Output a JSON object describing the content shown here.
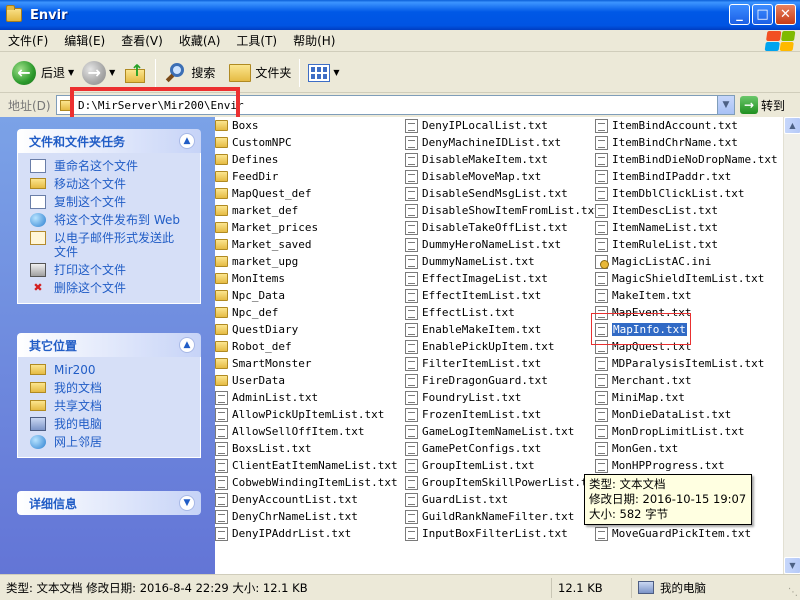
{
  "window": {
    "title": "Envir",
    "btn_minimize": "_",
    "btn_maximize": "□",
    "btn_close": "✕"
  },
  "menu": [
    "文件(F)",
    "编辑(E)",
    "查看(V)",
    "收藏(A)",
    "工具(T)",
    "帮助(H)"
  ],
  "toolbar": {
    "back": "后退",
    "search": "搜索",
    "folders": "文件夹"
  },
  "address": {
    "label": "地址(D)",
    "value": "D:\\MirServer\\Mir200\\Envir",
    "go": "转到"
  },
  "taskpane": {
    "file_tasks": {
      "title": "文件和文件夹任务",
      "items": [
        {
          "label": "重命名这个文件",
          "icon": "rename-icon"
        },
        {
          "label": "移动这个文件",
          "icon": "move-icon"
        },
        {
          "label": "复制这个文件",
          "icon": "copy-icon"
        },
        {
          "label": "将这个文件发布到 Web",
          "icon": "web-publish-icon"
        },
        {
          "label": "以电子邮件形式发送此文件",
          "icon": "email-icon"
        },
        {
          "label": "打印这个文件",
          "icon": "printer-icon"
        },
        {
          "label": "删除这个文件",
          "icon": "delete-icon"
        }
      ]
    },
    "other_places": {
      "title": "其它位置",
      "items": [
        {
          "label": "Mir200",
          "icon": "folder-icon"
        },
        {
          "label": "我的文档",
          "icon": "folder-icon"
        },
        {
          "label": "共享文档",
          "icon": "folder-icon"
        },
        {
          "label": "我的电脑",
          "icon": "computer-icon"
        },
        {
          "label": "网上邻居",
          "icon": "network-icon"
        }
      ]
    },
    "details": {
      "title": "详细信息"
    }
  },
  "files": {
    "col1": [
      {
        "name": "Boxs",
        "type": "folder"
      },
      {
        "name": "CustomNPC",
        "type": "folder"
      },
      {
        "name": "Defines",
        "type": "folder"
      },
      {
        "name": "FeedDir",
        "type": "folder"
      },
      {
        "name": "MapQuest_def",
        "type": "folder"
      },
      {
        "name": "market_def",
        "type": "folder"
      },
      {
        "name": "Market_prices",
        "type": "folder"
      },
      {
        "name": "Market_saved",
        "type": "folder"
      },
      {
        "name": "market_upg",
        "type": "folder"
      },
      {
        "name": "MonItems",
        "type": "folder"
      },
      {
        "name": "Npc_Data",
        "type": "folder"
      },
      {
        "name": "Npc_def",
        "type": "folder"
      },
      {
        "name": "QuestDiary",
        "type": "folder"
      },
      {
        "name": "Robot_def",
        "type": "folder"
      },
      {
        "name": "SmartMonster",
        "type": "folder"
      },
      {
        "name": "UserData",
        "type": "folder"
      },
      {
        "name": "AdminList.txt",
        "type": "txt"
      },
      {
        "name": "AllowPickUpItemList.txt",
        "type": "txt"
      },
      {
        "name": "AllowSellOffItem.txt",
        "type": "txt"
      },
      {
        "name": "BoxsList.txt",
        "type": "txt"
      },
      {
        "name": "ClientEatItemNameList.txt",
        "type": "txt"
      },
      {
        "name": "CobwebWindingItemList.txt",
        "type": "txt"
      },
      {
        "name": "DenyAccountList.txt",
        "type": "txt"
      },
      {
        "name": "DenyChrNameList.txt",
        "type": "txt"
      },
      {
        "name": "DenyIPAddrList.txt",
        "type": "txt"
      }
    ],
    "col2": [
      {
        "name": "DenyIPLocalList.txt",
        "type": "txt"
      },
      {
        "name": "DenyMachineIDList.txt",
        "type": "txt"
      },
      {
        "name": "DisableMakeItem.txt",
        "type": "txt"
      },
      {
        "name": "DisableMoveMap.txt",
        "type": "txt"
      },
      {
        "name": "DisableSendMsgList.txt",
        "type": "txt"
      },
      {
        "name": "DisableShowItemFromList.txt",
        "type": "txt"
      },
      {
        "name": "DisableTakeOffList.txt",
        "type": "txt"
      },
      {
        "name": "DummyHeroNameList.txt",
        "type": "txt"
      },
      {
        "name": "DummyNameList.txt",
        "type": "txt"
      },
      {
        "name": "EffectImageList.txt",
        "type": "txt"
      },
      {
        "name": "EffectItemList.txt",
        "type": "txt"
      },
      {
        "name": "EffectList.txt",
        "type": "txt"
      },
      {
        "name": "EnableMakeItem.txt",
        "type": "txt"
      },
      {
        "name": "EnablePickUpItem.txt",
        "type": "txt"
      },
      {
        "name": "FilterItemList.txt",
        "type": "txt"
      },
      {
        "name": "FireDragonGuard.txt",
        "type": "txt"
      },
      {
        "name": "FoundryList.txt",
        "type": "txt"
      },
      {
        "name": "FrozenItemList.txt",
        "type": "txt"
      },
      {
        "name": "GameLogItemNameList.txt",
        "type": "txt"
      },
      {
        "name": "GamePetConfigs.txt",
        "type": "txt"
      },
      {
        "name": "GroupItemList.txt",
        "type": "txt"
      },
      {
        "name": "GroupItemSkillPowerList.txt",
        "type": "txt"
      },
      {
        "name": "GuardList.txt",
        "type": "txt"
      },
      {
        "name": "GuildRankNameFilter.txt",
        "type": "txt"
      },
      {
        "name": "InputBoxFilterList.txt",
        "type": "txt"
      }
    ],
    "col3": [
      {
        "name": "ItemBindAccount.txt",
        "type": "txt"
      },
      {
        "name": "ItemBindChrName.txt",
        "type": "txt"
      },
      {
        "name": "ItemBindDieNoDropName.txt",
        "type": "txt"
      },
      {
        "name": "ItemBindIPaddr.txt",
        "type": "txt"
      },
      {
        "name": "ItemDblClickList.txt",
        "type": "txt"
      },
      {
        "name": "ItemDescList.txt",
        "type": "txt"
      },
      {
        "name": "ItemNameList.txt",
        "type": "txt"
      },
      {
        "name": "ItemRuleList.txt",
        "type": "txt"
      },
      {
        "name": "MagicListAC.ini",
        "type": "ini"
      },
      {
        "name": "MagicShieldItemList.txt",
        "type": "txt"
      },
      {
        "name": "MakeItem.txt",
        "type": "txt"
      },
      {
        "name": "MapEvent.txt",
        "type": "txt"
      },
      {
        "name": "MapInfo.txt",
        "type": "txt",
        "selected": true
      },
      {
        "name": "MapQuest.txt",
        "type": "txt"
      },
      {
        "name": "MDParalysisItemList.txt",
        "type": "txt"
      },
      {
        "name": "Merchant.txt",
        "type": "txt"
      },
      {
        "name": "MiniMap.txt",
        "type": "txt"
      },
      {
        "name": "MonDieDataList.txt",
        "type": "txt"
      },
      {
        "name": "MonDropLimitList.txt",
        "type": "txt"
      },
      {
        "name": "MonGen.txt",
        "type": "txt"
      },
      {
        "name": "MonHPProgress.txt",
        "type": "txt"
      },
      {
        "name": "",
        "type": "none"
      },
      {
        "name": "",
        "type": "none"
      },
      {
        "name": "",
        "type": "none"
      },
      {
        "name": "MoveGuardPickItem.txt",
        "type": "txt"
      }
    ]
  },
  "tooltip": {
    "line1": "类型: 文本文档",
    "line2": "修改日期: 2016-10-15 19:07",
    "line3": "大小: 582 字节"
  },
  "status": {
    "info": "类型: 文本文档 修改日期: 2016-8-4 22:29 大小: 12.1 KB",
    "size": "12.1 KB",
    "location": "我的电脑"
  },
  "colors": {
    "titlebar": "#0054e3",
    "selection": "#316ac5",
    "highlight": "#ec3030",
    "taskpane_link": "#215dc6"
  }
}
